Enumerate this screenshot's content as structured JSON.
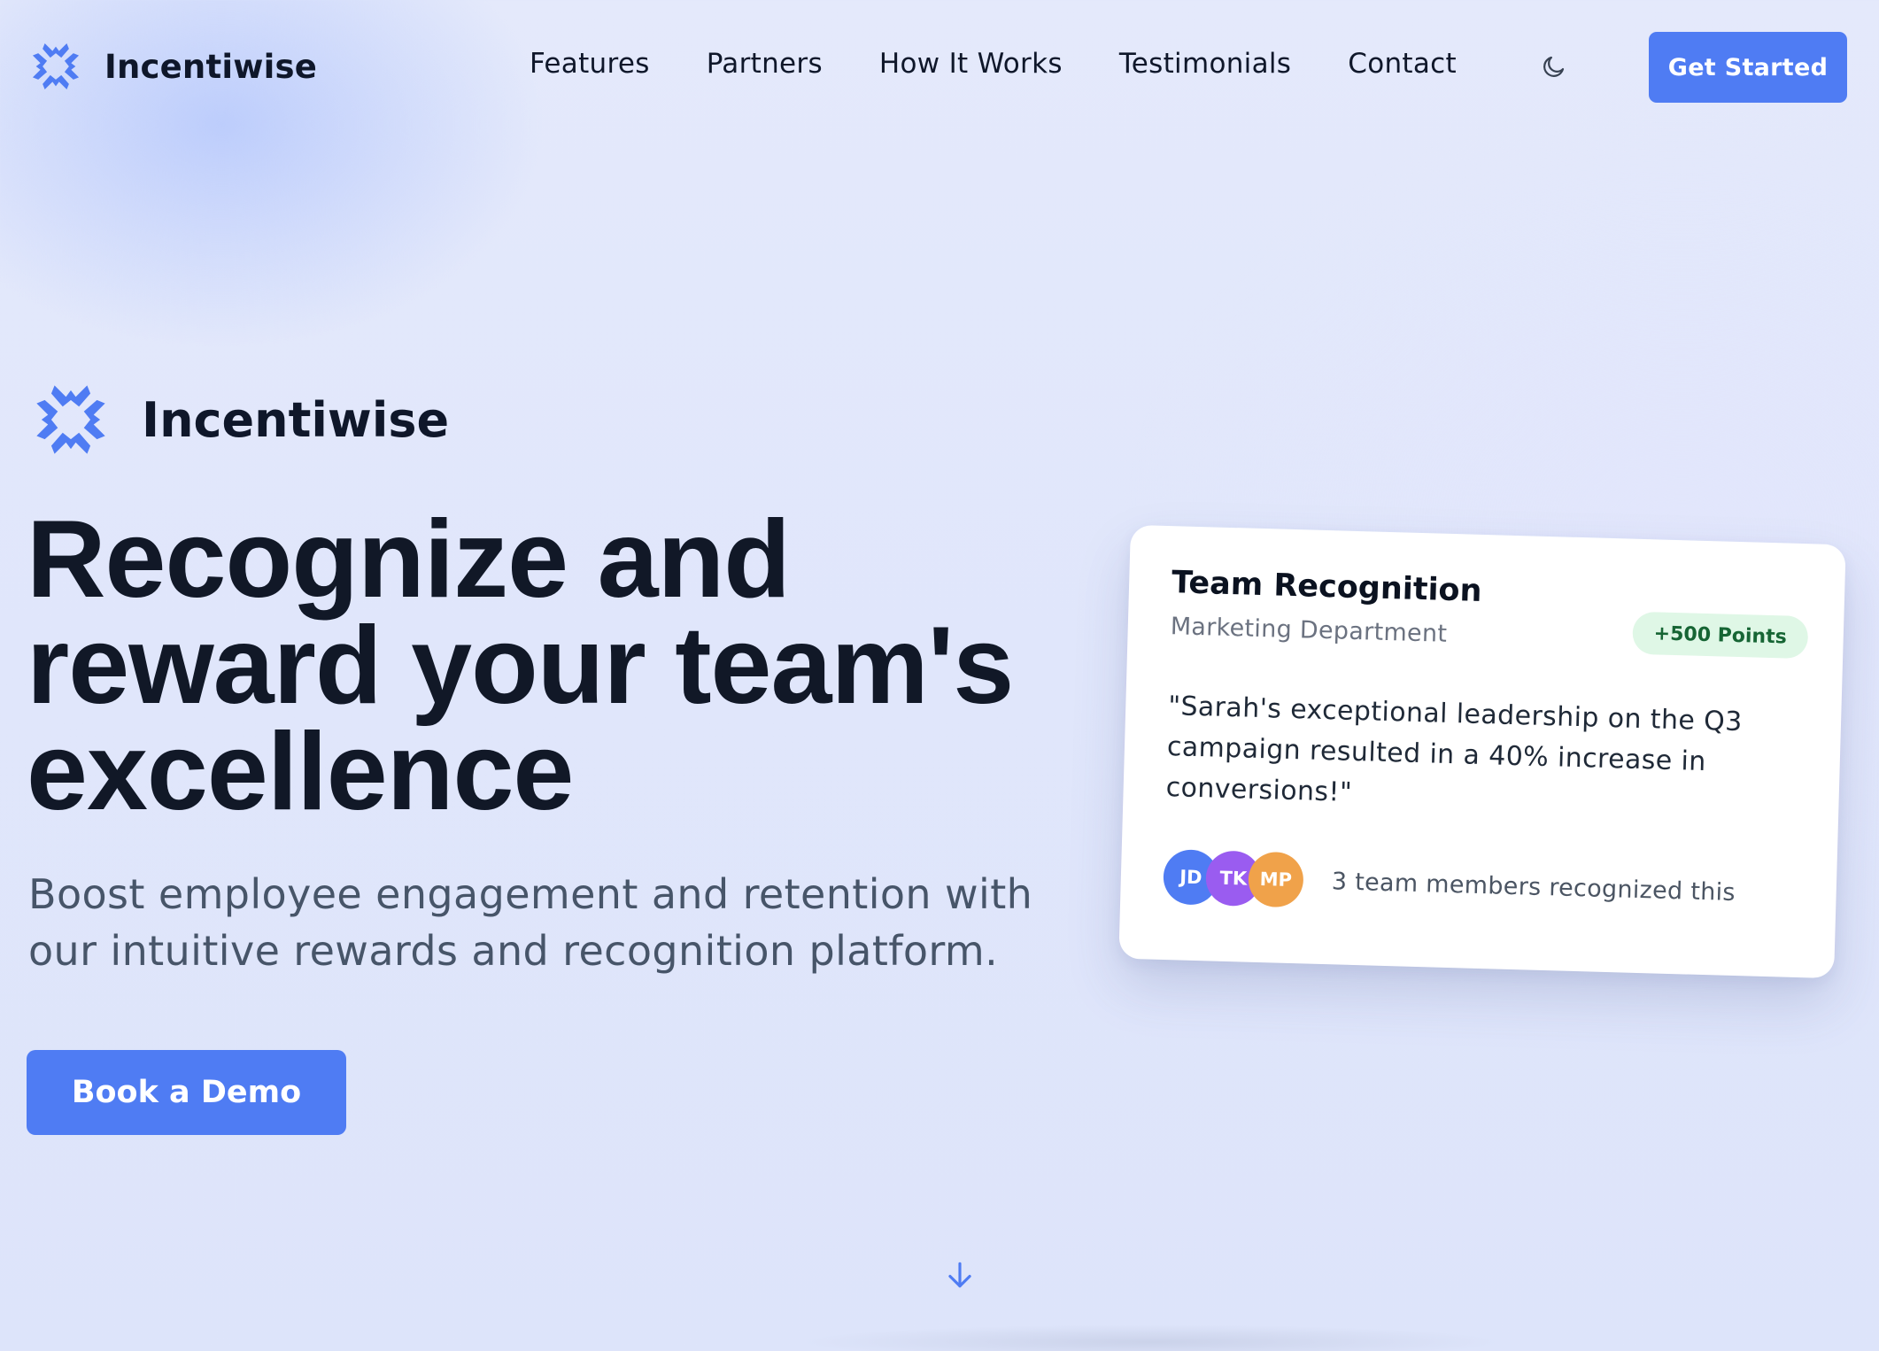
{
  "nav": {
    "brand_name": "Incentiwise",
    "links": [
      "Features",
      "Partners",
      "How It Works",
      "Testimonials",
      "Contact"
    ],
    "theme_icon": "moon-icon",
    "cta_label": "Get Started"
  },
  "hero": {
    "brand_name": "Incentiwise",
    "headline": "Recognize and reward your team's excellence",
    "subheadline": "Boost employee engagement and retention with our intuitive rewards and recognition platform.",
    "cta_label": "Book a Demo",
    "scroll_icon": "arrow-down-icon"
  },
  "card": {
    "title": "Team Recognition",
    "subtitle": "Marketing Department",
    "badge": "+500 Points",
    "quote": "\"Sarah's exceptional leadership on the Q3 campaign resulted in a 40% increase in conversions!\"",
    "avatars": [
      {
        "initials": "JD",
        "color": "#4f7cf3"
      },
      {
        "initials": "TK",
        "color": "#9a5cf0"
      },
      {
        "initials": "MP",
        "color": "#f0a24a"
      }
    ],
    "footer_text": "3 team members recognized this"
  },
  "colors": {
    "accent": "#4f7cf3",
    "badge_bg": "#dff7e6",
    "badge_text": "#166534"
  }
}
